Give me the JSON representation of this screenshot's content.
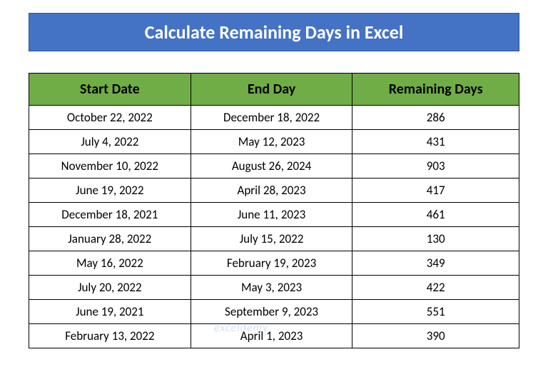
{
  "title": "Calculate Remaining Days in Excel",
  "columns": {
    "start": "Start Date",
    "end": "End Day",
    "remaining": "Remaining Days"
  },
  "rows": [
    {
      "start": "October 22, 2022",
      "end": "December 18, 2022",
      "remaining": "286"
    },
    {
      "start": "July 4, 2022",
      "end": "May 12, 2023",
      "remaining": "431"
    },
    {
      "start": "November 10, 2022",
      "end": "August 26, 2024",
      "remaining": "903"
    },
    {
      "start": "June 19, 2022",
      "end": "April 28, 2023",
      "remaining": "417"
    },
    {
      "start": "December 18, 2021",
      "end": "June 11, 2023",
      "remaining": "461"
    },
    {
      "start": "January 28, 2022",
      "end": "July 15, 2022",
      "remaining": "130"
    },
    {
      "start": "May 16, 2022",
      "end": "February 19, 2023",
      "remaining": "349"
    },
    {
      "start": "July 20, 2022",
      "end": "May 3, 2023",
      "remaining": "422"
    },
    {
      "start": "June 19, 2021",
      "end": "September 9, 2023",
      "remaining": "551"
    },
    {
      "start": "February 13, 2022",
      "end": "April 1, 2023",
      "remaining": "390"
    }
  ],
  "watermark": "exceldemy"
}
